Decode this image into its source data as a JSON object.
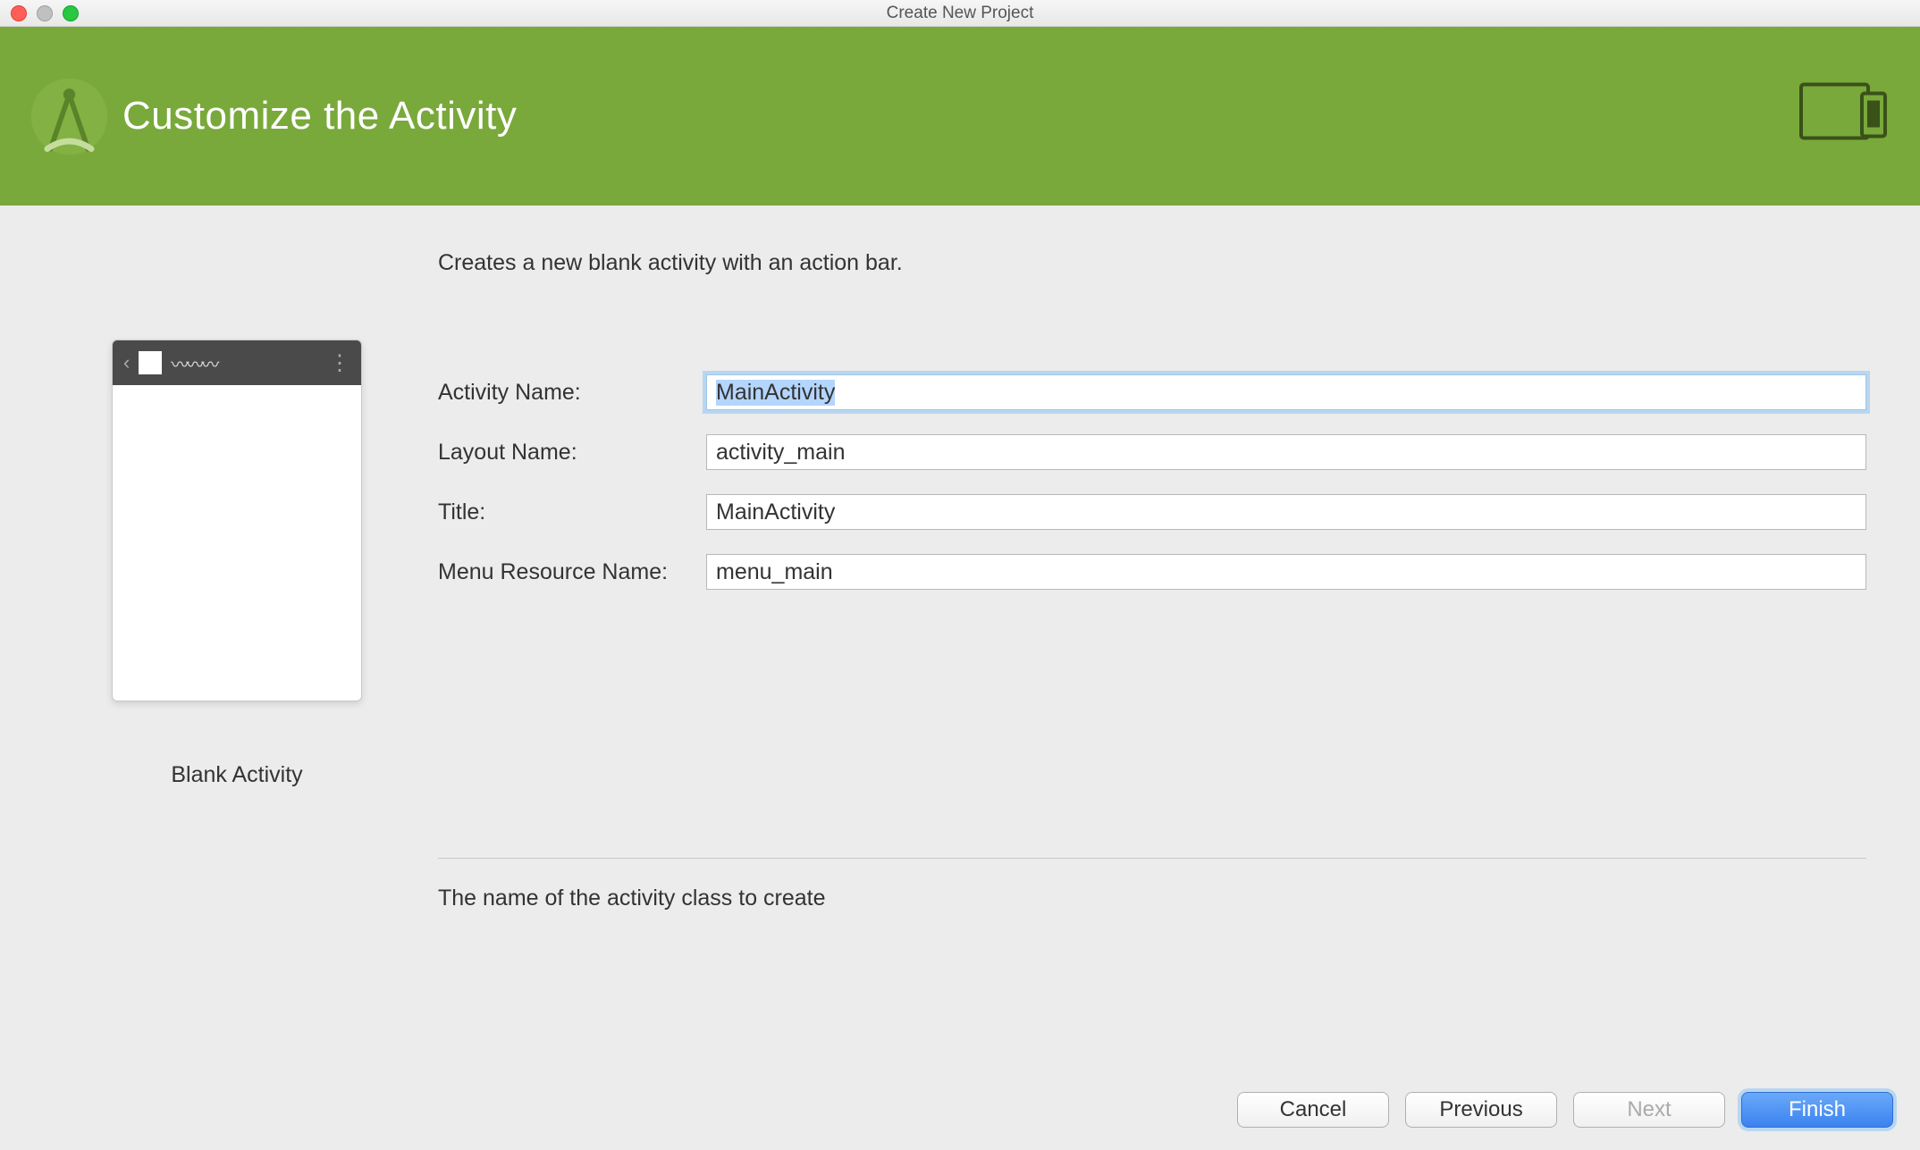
{
  "window": {
    "title": "Create New Project"
  },
  "header": {
    "title": "Customize the Activity"
  },
  "description": "Creates a new blank activity with an action bar.",
  "preview": {
    "label": "Blank Activity"
  },
  "form": {
    "fields": [
      {
        "label": "Activity Name:",
        "value": "MainActivity",
        "focused": true
      },
      {
        "label": "Layout Name:",
        "value": "activity_main",
        "focused": false
      },
      {
        "label": "Title:",
        "value": "MainActivity",
        "focused": false
      },
      {
        "label": "Menu Resource Name:",
        "value": "menu_main",
        "focused": false
      }
    ]
  },
  "hint": "The name of the activity class to create",
  "buttons": {
    "cancel": "Cancel",
    "previous": "Previous",
    "next": "Next",
    "finish": "Finish"
  }
}
